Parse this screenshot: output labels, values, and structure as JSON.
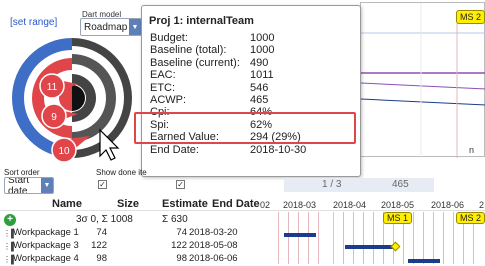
{
  "toolbar": {
    "set_range": "[set range]",
    "dart_model_label": "Dart model",
    "dart_model_value": "Roadmap"
  },
  "dart": {
    "rings": [
      "11",
      "9",
      "10"
    ]
  },
  "milestones": {
    "ms2_top": "MS 2",
    "ms1": "MS 1",
    "ms2": "MS 2"
  },
  "popup": {
    "title": "Proj 1: internalTeam",
    "rows": [
      {
        "label": "Budget:",
        "value": "1000"
      },
      {
        "label": "Baseline (total):",
        "value": "1000"
      },
      {
        "label": "Baseline (current):",
        "value": "490"
      },
      {
        "label": "EAC:",
        "value": "1011"
      },
      {
        "label": "ETC:",
        "value": "546"
      },
      {
        "label": "ACWP:",
        "value": "465"
      },
      {
        "label": "Cpi:",
        "value": "64%"
      },
      {
        "label": "Spi:",
        "value": "62%"
      },
      {
        "label": "Earned Value:",
        "value": "294 (29%)"
      },
      {
        "label": "End Date:",
        "value": "2018-10-30"
      }
    ]
  },
  "controls": {
    "sort_order_label": "Sort order",
    "sort_order_value": "Start date",
    "show_done_label": "Show done ite",
    "pager_page": "1 / 3",
    "pager_number": "465"
  },
  "table": {
    "headers": {
      "name": "Name",
      "size": "Size",
      "estimate": "Estimate",
      "end_date": "End Date"
    },
    "months": [
      "02",
      "2018-03",
      "2018-04",
      "2018-05",
      "2018-06",
      "2"
    ],
    "summary": {
      "size": "3σ 0, Σ 1008",
      "estimate": "Σ 630"
    },
    "rows": [
      {
        "name": "Workpackage 1",
        "size": "74",
        "estimate": "74",
        "end_date": "2018-03-20"
      },
      {
        "name": "Workpackage 3",
        "size": "122",
        "estimate": "122",
        "end_date": "2018-05-08"
      },
      {
        "name": "Workpackage 4",
        "size": "98",
        "estimate": "98",
        "end_date": "2018-06-06"
      }
    ]
  },
  "colors": {
    "accent": "#2a57c9",
    "dart_blue": "#3f6ec6",
    "dart_red": "#e0454a",
    "highlight_box": "#e0454a",
    "milestone": "#ffee00",
    "gantt_bar": "#1b3c8c"
  }
}
